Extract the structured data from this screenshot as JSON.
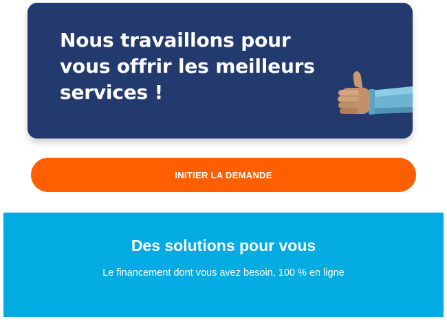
{
  "hero": {
    "title": "Nous travaillons pour vous offrir les meilleurs services !",
    "card_color": "#223a6e",
    "icon": "thumbs-up-icon"
  },
  "cta": {
    "label": "INITIER LA DEMANDE",
    "color": "#ff5f00"
  },
  "solutions": {
    "title": "Des solutions pour vous",
    "subtitle": "Le financement dont vous avez besoin, 100 % en ligne",
    "background_color": "#03abe3"
  }
}
